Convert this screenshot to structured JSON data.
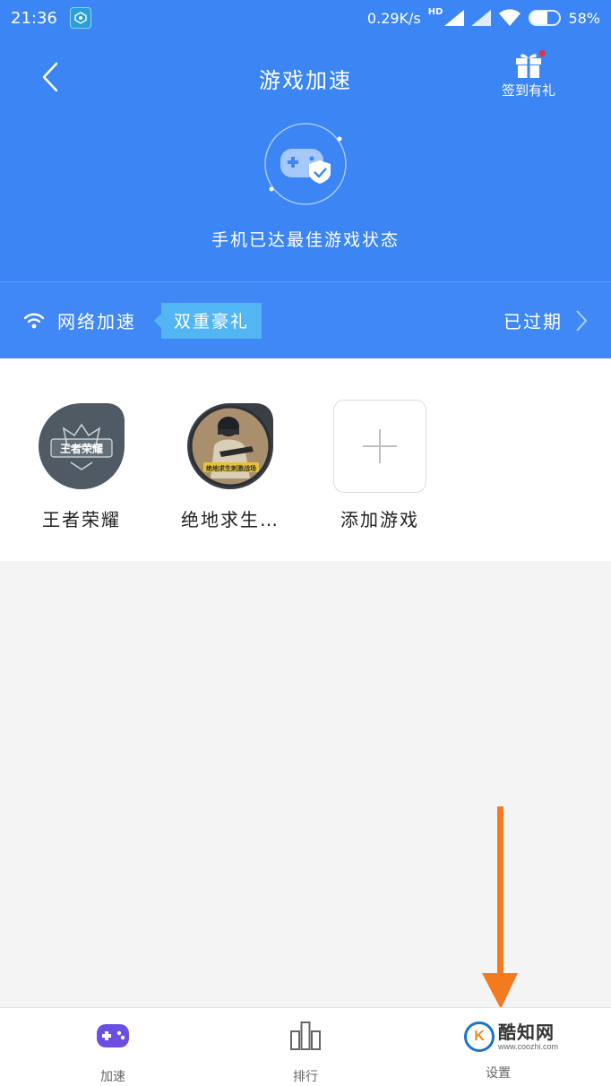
{
  "status_bar": {
    "time": "21:36",
    "network_speed": "0.29K/s",
    "hd": "HD",
    "battery": "58%",
    "battery_level": 0.58
  },
  "nav": {
    "title": "游戏加速",
    "checkin_label": "签到有礼"
  },
  "hero": {
    "state_text": "手机已达最佳游戏状态"
  },
  "network": {
    "label": "网络加速",
    "promo": "双重豪礼",
    "status": "已过期"
  },
  "games": [
    {
      "label": "王者荣耀",
      "icon": "honor-of-kings-icon",
      "icon_text": "王者荣耀"
    },
    {
      "label": "绝地求生…",
      "icon": "pubg-icon",
      "icon_text": "绝地求生刺激战场"
    },
    {
      "label": "添加游戏",
      "icon": "add-icon"
    }
  ],
  "tabs": [
    {
      "label": "加速",
      "icon": "gamepad-icon"
    },
    {
      "label": "排行",
      "icon": "bar-chart-icon"
    },
    {
      "label": "设置",
      "icon": "settings-icon"
    }
  ],
  "watermark": {
    "logo": "K",
    "title": "酷知网",
    "url": "www.coozhi.com"
  },
  "colors": {
    "header_blue": "#3b85f4",
    "promo_blue": "#52b6f3",
    "gamepad_purple": "#6b4fe0",
    "arrow_orange": "#f47a1f"
  }
}
